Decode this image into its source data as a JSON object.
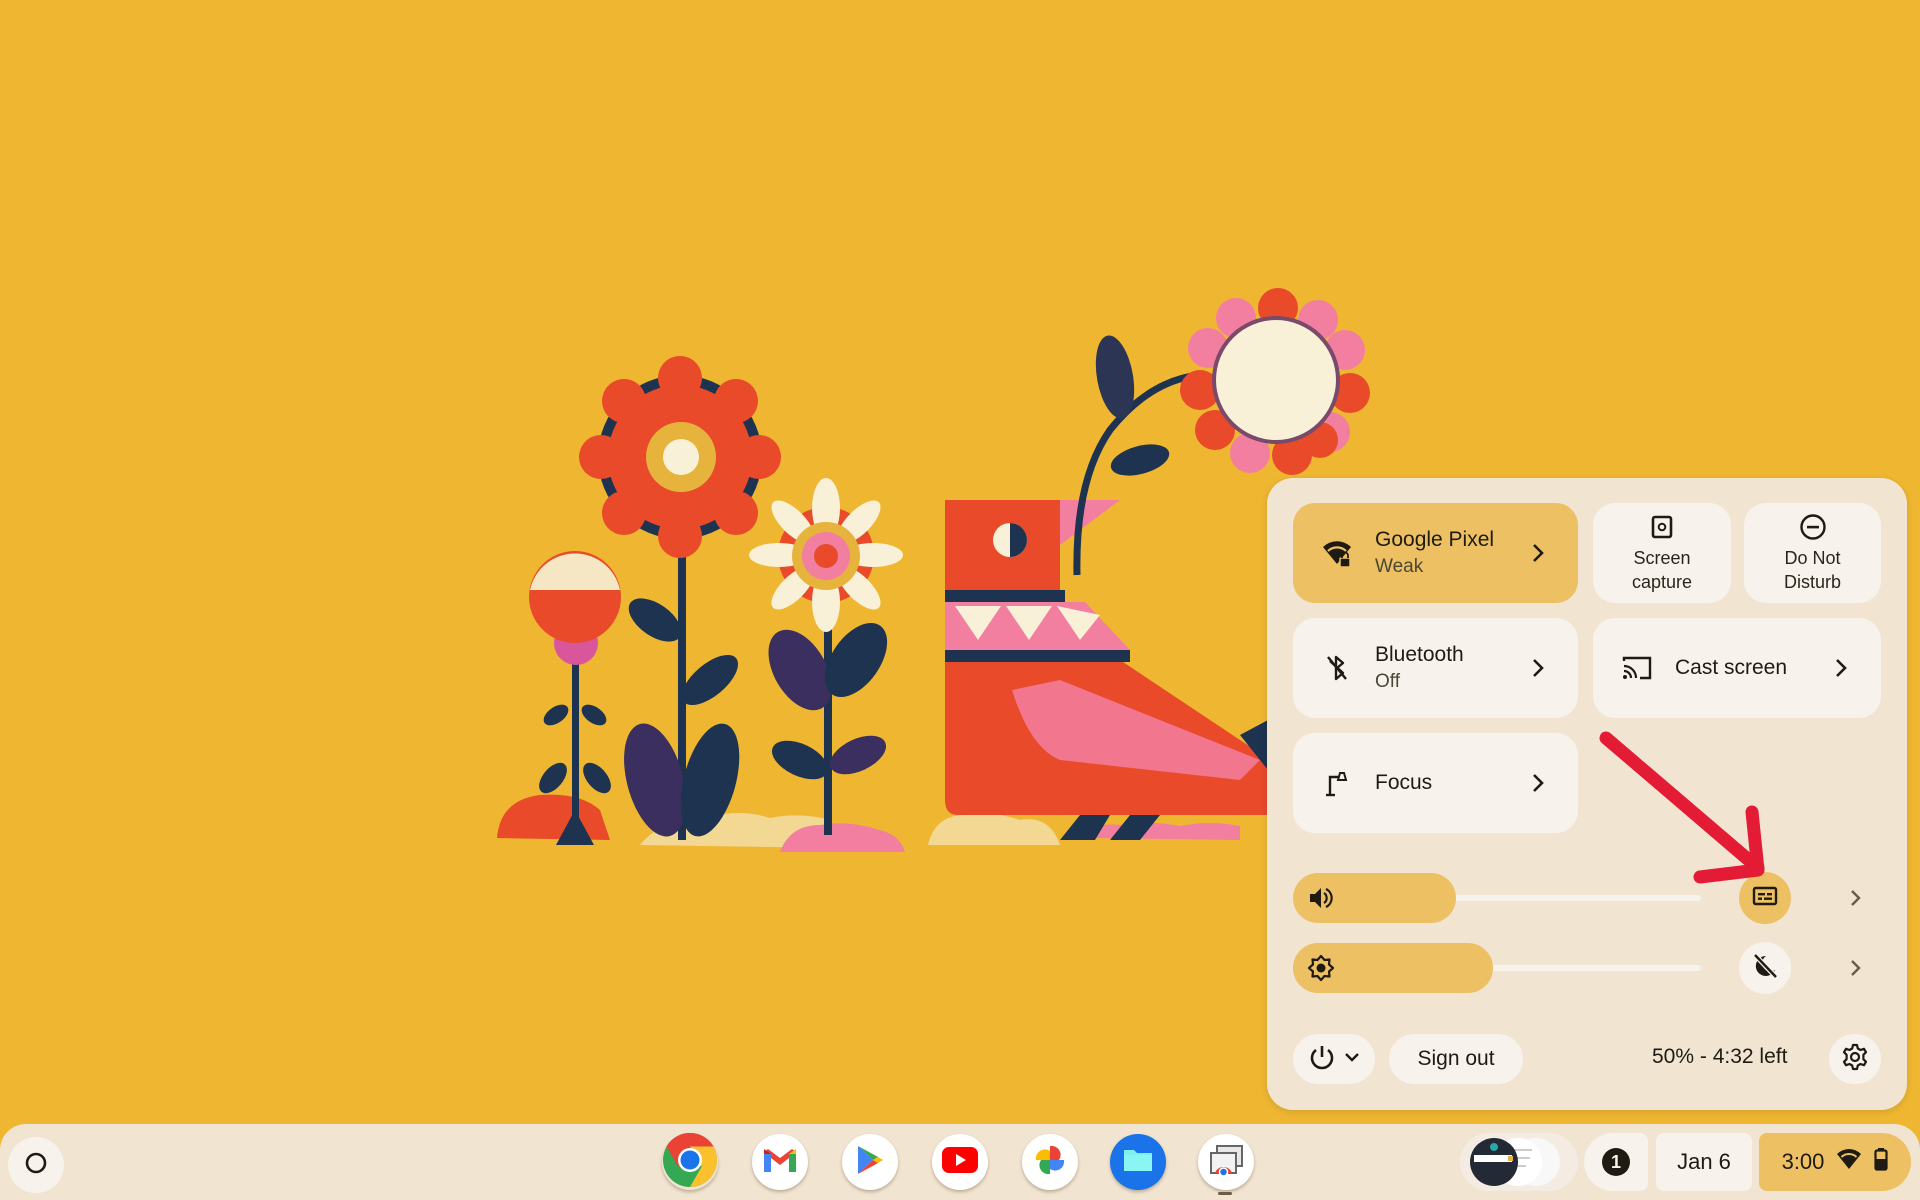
{
  "colors": {
    "wallpaper_bg": "#efb731",
    "panel_bg": "#f1e4d1",
    "tile_bg": "#f7f2ec",
    "tile_active": "#ecc063",
    "annotation_arrow": "#e31b34"
  },
  "quick_settings": {
    "network_tile": {
      "label": "Google Pixel",
      "sublabel": "Weak",
      "icon": "wifi-weak-locked-icon",
      "active": true
    },
    "screen_capture": {
      "label_line1": "Screen",
      "label_line2": "capture",
      "icon": "screen-capture-icon"
    },
    "do_not_disturb": {
      "label_line1": "Do Not",
      "label_line2": "Disturb",
      "icon": "do-not-disturb-icon"
    },
    "bluetooth_tile": {
      "label": "Bluetooth",
      "sublabel": "Off",
      "icon": "bluetooth-off-icon",
      "active": false
    },
    "cast_tile": {
      "label": "Cast screen",
      "icon": "cast-icon"
    },
    "focus_tile": {
      "label": "Focus",
      "icon": "focus-lamp-icon"
    },
    "volume": {
      "level_percent": 40,
      "icon": "volume-icon",
      "side_button_icon": "live-caption-icon",
      "side_button_active": true
    },
    "brightness": {
      "level_percent": 49,
      "icon": "brightness-icon",
      "side_button_icon": "night-light-off-icon",
      "side_button_active": false
    },
    "footer": {
      "power_icon": "power-icon",
      "sign_out_label": "Sign out",
      "battery_text": "50% - 4:32 left",
      "settings_icon": "settings-gear-icon"
    }
  },
  "shelf": {
    "launcher_icon": "launcher-circle-icon",
    "apps": [
      {
        "name": "Chrome",
        "icon": "chrome-icon"
      },
      {
        "name": "Gmail",
        "icon": "gmail-icon"
      },
      {
        "name": "Play Store",
        "icon": "play-store-icon"
      },
      {
        "name": "YouTube",
        "icon": "youtube-icon"
      },
      {
        "name": "Photos",
        "icon": "photos-icon"
      },
      {
        "name": "Files",
        "icon": "files-icon"
      },
      {
        "name": "Chrome Remote Desktop",
        "icon": "remote-desktop-icon",
        "running": true
      }
    ],
    "tray": {
      "notification_count": "1",
      "date": "Jan 6",
      "time": "3:00"
    }
  }
}
